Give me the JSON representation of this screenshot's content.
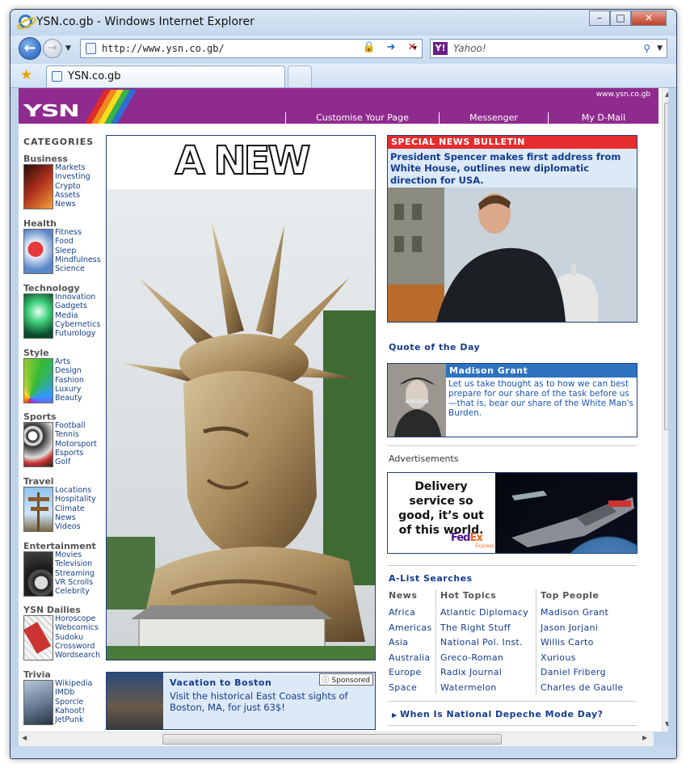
{
  "window": {
    "title": "YSN.co.gb - Windows Internet Explorer",
    "controls": {
      "minimize": "–",
      "maximize": "□",
      "close": "✕"
    }
  },
  "nav": {
    "url": "http://www.ysn.co.gb/",
    "search_placeholder": "Yahoo!",
    "yahoo_badge": "Y!"
  },
  "tabs": [
    {
      "label": "YSN.co.gb"
    }
  ],
  "site": {
    "domain": "www.ysn.co.gb",
    "logo": "YSN",
    "header_links": [
      "Customise Your Page",
      "Messenger",
      "My D-Mail"
    ]
  },
  "categories": {
    "heading": "CATEGORIES",
    "groups": [
      {
        "title": "Business",
        "links": [
          "Markets",
          "Investing",
          "Crypto",
          "Assets",
          "News"
        ]
      },
      {
        "title": "Health",
        "links": [
          "Fitness",
          "Food",
          "Sleep",
          "Mindfulness",
          "Science"
        ]
      },
      {
        "title": "Technology",
        "links": [
          "Innovation",
          "Gadgets",
          "Media",
          "Cybernetics",
          "Futurology"
        ]
      },
      {
        "title": "Style",
        "links": [
          "Arts",
          "Design",
          "Fashion",
          "Luxury",
          "Beauty"
        ]
      },
      {
        "title": "Sports",
        "links": [
          "Football",
          "Tennis",
          "Motorsport",
          "Esports",
          "Golf"
        ]
      },
      {
        "title": "Travel",
        "links": [
          "Locations",
          "Hospitality",
          "Climate",
          "News",
          "Videos"
        ]
      },
      {
        "title": "Entertainment",
        "links": [
          "Movies",
          "Television",
          "Streaming",
          "VR Scrolls",
          "Celebrity"
        ]
      },
      {
        "title": "YSN Dailies",
        "links": [
          "Horoscope",
          "Webcomics",
          "Sudoku",
          "Crossword",
          "Wordsearch"
        ]
      },
      {
        "title": "Trivia",
        "links": [
          "Wikipedia",
          "IMDb",
          "Sporcle",
          "Kahoot!",
          "JetPunk"
        ]
      }
    ]
  },
  "main": {
    "headline": "A NEW COLOSSUS"
  },
  "vacation": {
    "title": "Vacation to Boston",
    "text": "Visit the historical East Coast sights of Boston, MA, for just 63$!",
    "sponsored": "Sponsored"
  },
  "bulletin": {
    "heading": "SPECIAL NEWS BULLETIN",
    "text": "President Spencer makes first address from White House, outlines new diplomatic direction for USA."
  },
  "quote": {
    "section": "Quote of the Day",
    "name": "Madison Grant",
    "text": "Let us take thought as to how we can best prepare for our share of the task before us—that is, bear our share of the White Man's Burden."
  },
  "ads": {
    "label": "Advertisements",
    "text": "Delivery service so good, it’s out of this world.",
    "brand_fed": "Fed",
    "brand_ex": "Ex",
    "brand_sub": "Express"
  },
  "alist": {
    "section": "A-List Searches",
    "columns": [
      {
        "header": "News",
        "items": [
          "Africa",
          "Americas",
          "Asia",
          "Australia",
          "Europe",
          "Space"
        ]
      },
      {
        "header": "Hot Topics",
        "items": [
          "Atlantic Diplomacy",
          "The Right Stuff",
          "National Pol. Inst.",
          "Greco-Roman",
          "Radix Journal",
          "Watermelon"
        ]
      },
      {
        "header": "Top People",
        "items": [
          "Madison Grant",
          "Jason Jorjani",
          "Willis Carto",
          "Xurious",
          "Daniel Friberg",
          "Charles de Gaulle"
        ]
      }
    ],
    "footer_link": "When Is National Depeche Mode Day?"
  },
  "colors": {
    "header_purple": "#8f2b8e",
    "link_blue": "#143c8f",
    "bulletin_red": "#e52d2d",
    "panel_blue": "#dce9f6",
    "quote_bar": "#2d73c0"
  }
}
